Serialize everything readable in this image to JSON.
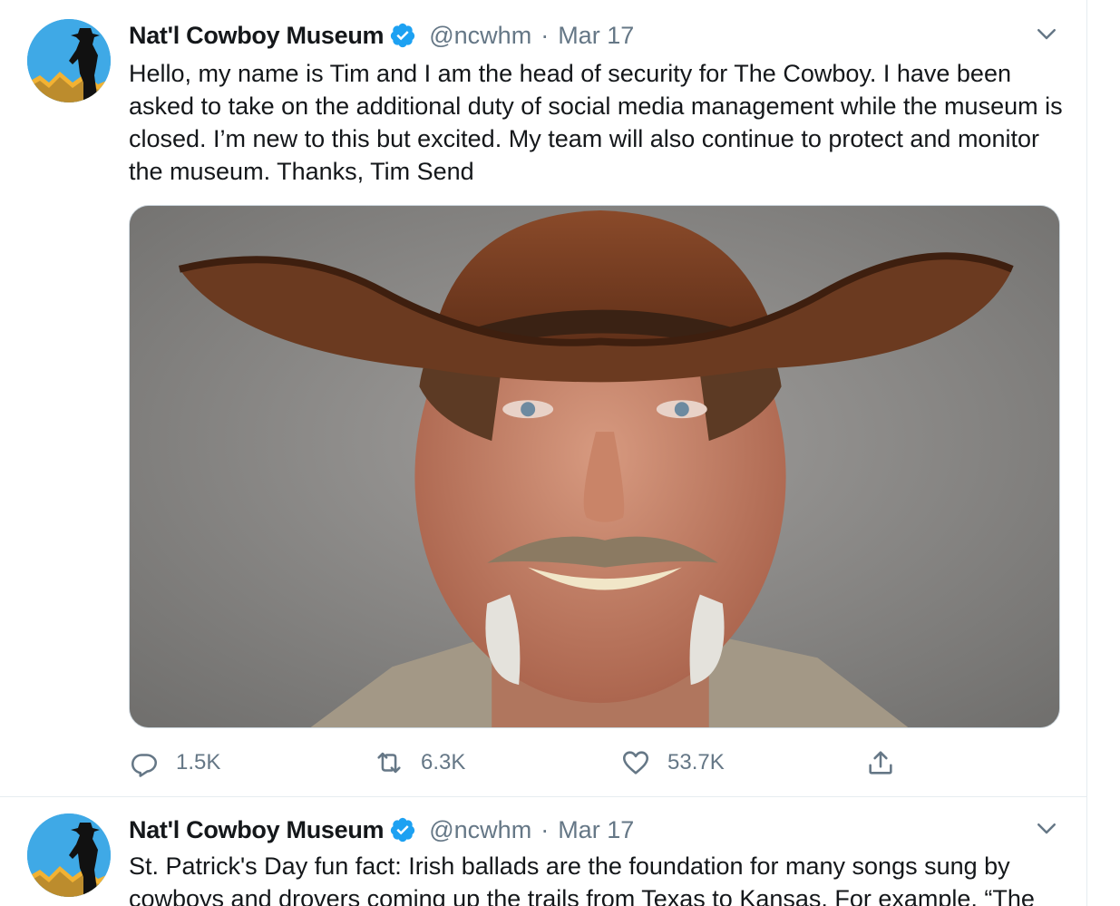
{
  "tweets": [
    {
      "display_name": "Nat'l Cowboy Museum",
      "handle": "@ncwhm",
      "separator": "·",
      "date": "Mar 17",
      "verified": true,
      "text": "Hello, my name is Tim and I am the head of security for The Cowboy. I have been asked to take on the additional duty of social media management while the museum is closed. I’m new to this but excited. My team will also continue to protect and monitor the museum. Thanks, Tim Send",
      "media": "photo",
      "counts": {
        "replies": "1.5K",
        "retweets": "6.3K",
        "likes": "53.7K"
      }
    },
    {
      "display_name": "Nat'l Cowboy Museum",
      "handle": "@ncwhm",
      "separator": "·",
      "date": "Mar 17",
      "verified": true,
      "text": "St. Patrick's Day fun fact: Irish ballads are the foundation for many songs sung by cowboys and drovers coming up the trails from Texas to Kansas. For example, “The"
    }
  ],
  "icons": {
    "avatar": "cowboy-silhouette-logo",
    "verified": "verified-badge-icon",
    "caret": "chevron-down-icon",
    "reply": "reply-icon",
    "retweet": "retweet-icon",
    "like": "heart-icon",
    "share": "share-icon"
  },
  "colors": {
    "text": "#14171a",
    "secondary": "#657786",
    "verified": "#1da1f2",
    "divider": "#e6ecf0",
    "avatar_bg": "#3fa9e6",
    "avatar_mountain": "#f2b233"
  }
}
